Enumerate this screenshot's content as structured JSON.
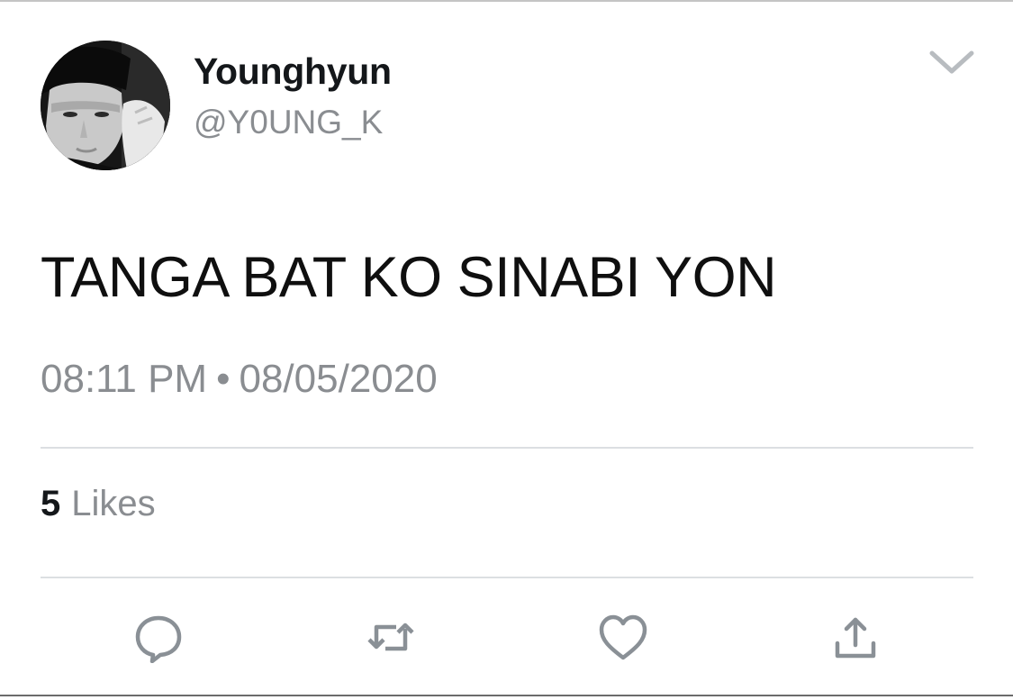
{
  "tweet": {
    "author": {
      "display_name": "Younghyun",
      "handle": "@Y0UNG_K",
      "avatar_icon": "profile-photo"
    },
    "text": "TANGA BAT KO SINABI YON",
    "time": "08:11 PM",
    "separator": "•",
    "date": "08/05/2020",
    "likes": {
      "count": "5",
      "label": "Likes"
    }
  },
  "actions": [
    {
      "name": "reply",
      "icon": "reply-icon"
    },
    {
      "name": "retweet",
      "icon": "retweet-icon"
    },
    {
      "name": "like",
      "icon": "heart-icon"
    },
    {
      "name": "share",
      "icon": "share-icon"
    }
  ],
  "colors": {
    "text_primary": "#14171a",
    "text_secondary": "#8a8d91",
    "icon": "#8a9096",
    "divider": "#dcdfe2"
  }
}
